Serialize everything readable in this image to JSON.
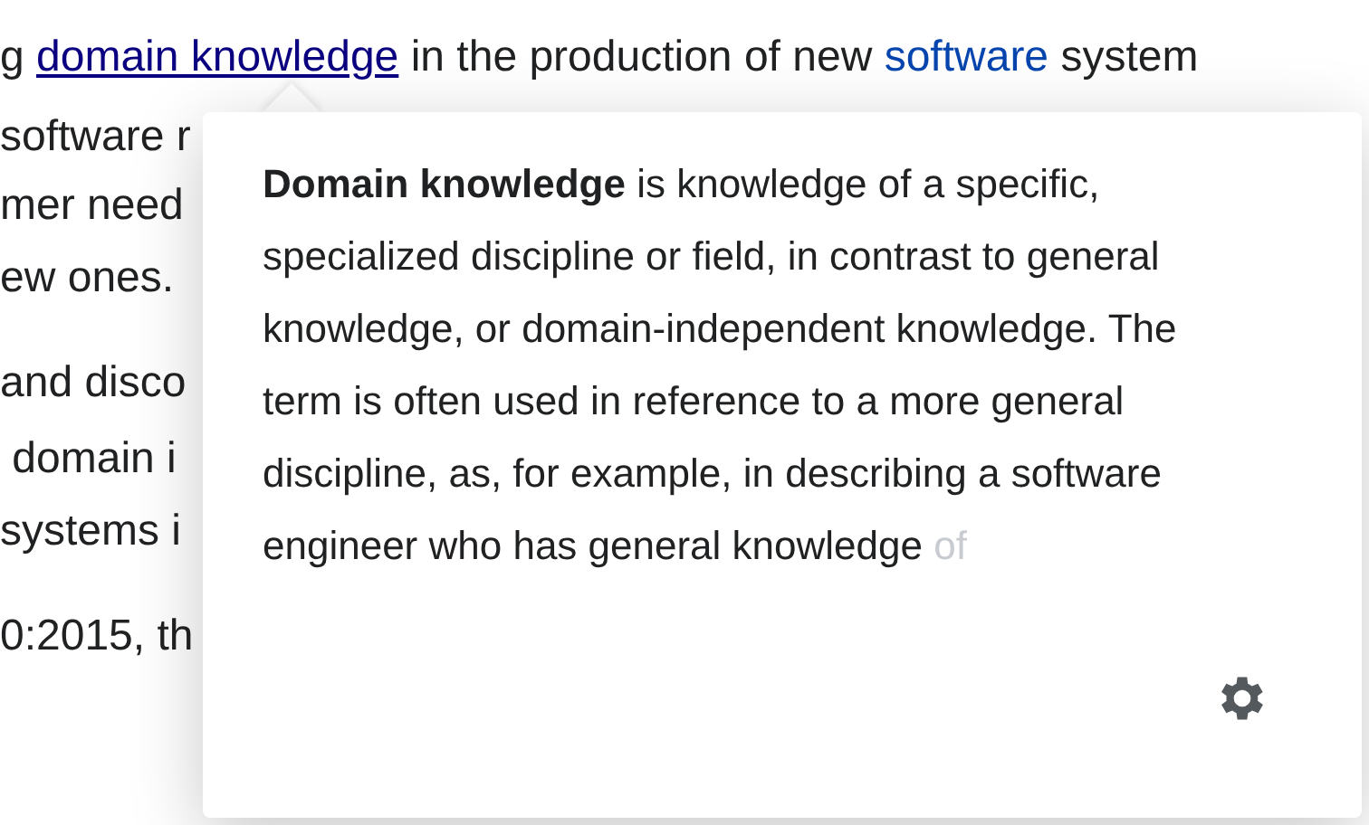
{
  "article": {
    "lines": [
      {
        "parts": [
          {
            "kind": "text",
            "text": "g "
          },
          {
            "kind": "link",
            "visited": true,
            "text": "domain knowledge"
          },
          {
            "kind": "text",
            "text": " in the production of new "
          },
          {
            "kind": "link",
            "visited": false,
            "text": "software"
          },
          {
            "kind": "text",
            "text": " system"
          }
        ]
      },
      {
        "parts": [
          {
            "kind": "text",
            "text": "software r"
          }
        ]
      },
      {
        "parts": [
          {
            "kind": "text",
            "text": "mer need"
          }
        ]
      },
      {
        "parts": [
          {
            "kind": "text",
            "text": "ew ones."
          }
        ]
      },
      {
        "parts": [
          {
            "kind": "text",
            "text": "and disco"
          }
        ]
      },
      {
        "parts": [
          {
            "kind": "text",
            "text": " domain i"
          }
        ]
      },
      {
        "parts": [
          {
            "kind": "text",
            "text": "systems i"
          }
        ]
      },
      {
        "parts": [
          {
            "kind": "text",
            "text": "0:2015, th"
          }
        ]
      }
    ]
  },
  "preview": {
    "extract": "**Domain knowledge** is knowledge of a specific, specialized discipline or field, in contrast to general knowledge, or domain-independent knowledge. The term is often used in reference to a more general discipline, as, for example, in describing a software engineer who has general knowledge",
    "extract_fade": "of"
  }
}
